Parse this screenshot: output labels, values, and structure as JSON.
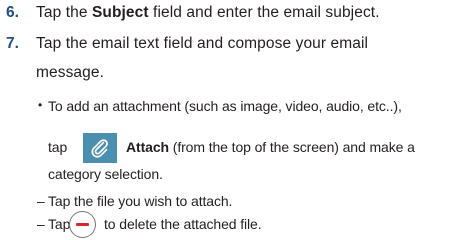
{
  "steps": [
    {
      "number": "6.",
      "parts": {
        "a": "Tap the ",
        "b": "Subject",
        "c": " field and enter the email subject."
      }
    },
    {
      "number": "7.",
      "line1": "Tap the email text field and compose your email",
      "line2": "message."
    }
  ],
  "bullet": {
    "dot": "•",
    "line1": "To add an attachment (such as image, video, audio, etc..),",
    "line2_pre": "tap",
    "attach_label": "Attach",
    "line2_post": " (from the top of the screen) and make a",
    "line3": "category selection."
  },
  "sub_items": [
    {
      "dash": "–",
      "text": "Tap the file you wish to attach."
    },
    {
      "dash": "–",
      "pre": "Tap",
      "post": "to delete the attached file."
    }
  ],
  "icons": {
    "attach": "paperclip-icon",
    "remove": "minus-circle-icon"
  },
  "colors": {
    "step_number": "#1e4f8a",
    "attach_bg": "#4a8fb0",
    "remove_minus": "#d9262e"
  }
}
